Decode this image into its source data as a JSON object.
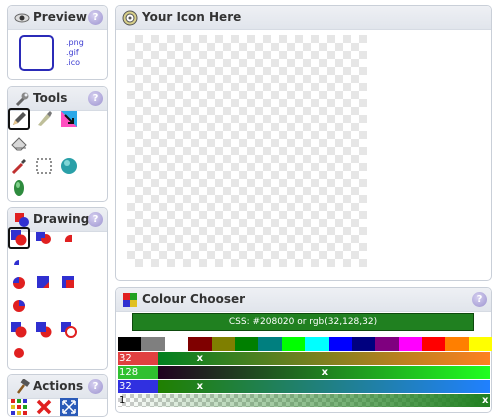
{
  "panels": {
    "preview": {
      "title": "Preview",
      "formats": [
        ".png",
        ".gif",
        ".ico"
      ]
    },
    "tools": {
      "title": "Tools"
    },
    "drawing": {
      "title": "Drawing"
    },
    "actions": {
      "title": "Actions"
    },
    "canvas": {
      "title": "Your Icon Here"
    },
    "colour_chooser": {
      "title": "Colour Chooser"
    }
  },
  "help_label": "?",
  "colour": {
    "css_text": "CSS: #208020 or rgb(32,128,32)",
    "hex": "#208020",
    "red": {
      "label": "32",
      "value": 32,
      "marker": "x",
      "color": "#e04040"
    },
    "green": {
      "label": "128",
      "value": 128,
      "marker": "x",
      "color": "#30c030"
    },
    "blue": {
      "label": "32",
      "value": 32,
      "marker": "x",
      "color": "#3030e0"
    },
    "alpha": {
      "label": "1",
      "value": 1,
      "marker": "x"
    },
    "palette": [
      "#000000",
      "#7f7f7f",
      "#ffffff",
      "#7f0000",
      "#7f7f00",
      "#007f00",
      "#007f7f",
      "#00ff00",
      "#00ffff",
      "#0000ff",
      "#00007f",
      "#7f007f",
      "#ff00ff",
      "#ff0000",
      "#ff7f00",
      "#ffff00"
    ]
  }
}
